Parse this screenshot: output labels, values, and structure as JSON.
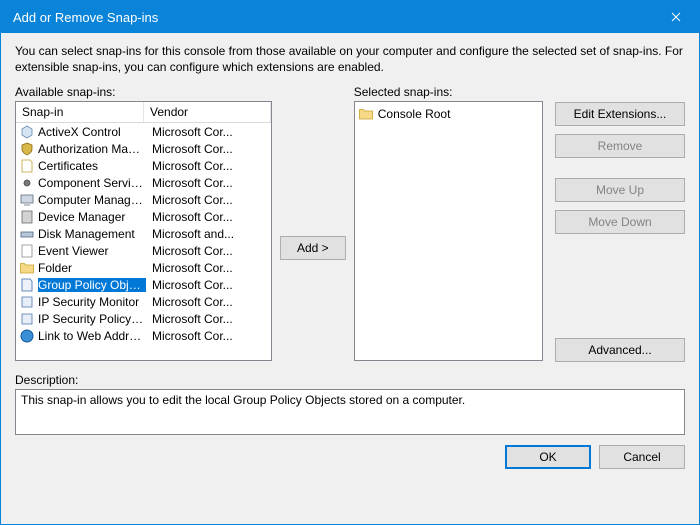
{
  "title": "Add or Remove Snap-ins",
  "intro": "You can select snap-ins for this console from those available on your computer and configure the selected set of snap-ins. For extensible snap-ins, you can configure which extensions are enabled.",
  "labels": {
    "available": "Available snap-ins:",
    "selected": "Selected snap-ins:",
    "description": "Description:"
  },
  "columns": {
    "snapin": "Snap-in",
    "vendor": "Vendor"
  },
  "available": [
    {
      "name": "ActiveX Control",
      "vendor": "Microsoft Cor...",
      "icon": "cube"
    },
    {
      "name": "Authorization Manager",
      "vendor": "Microsoft Cor...",
      "icon": "shield"
    },
    {
      "name": "Certificates",
      "vendor": "Microsoft Cor...",
      "icon": "cert"
    },
    {
      "name": "Component Services",
      "vendor": "Microsoft Cor...",
      "icon": "gear"
    },
    {
      "name": "Computer Managem...",
      "vendor": "Microsoft Cor...",
      "icon": "computer"
    },
    {
      "name": "Device Manager",
      "vendor": "Microsoft Cor...",
      "icon": "device"
    },
    {
      "name": "Disk Management",
      "vendor": "Microsoft and...",
      "icon": "disk"
    },
    {
      "name": "Event Viewer",
      "vendor": "Microsoft Cor...",
      "icon": "event"
    },
    {
      "name": "Folder",
      "vendor": "Microsoft Cor...",
      "icon": "folder"
    },
    {
      "name": "Group Policy Object ...",
      "vendor": "Microsoft Cor...",
      "icon": "gpo",
      "selected": true
    },
    {
      "name": "IP Security Monitor",
      "vendor": "Microsoft Cor...",
      "icon": "ipsec"
    },
    {
      "name": "IP Security Policy M...",
      "vendor": "Microsoft Cor...",
      "icon": "ipsec"
    },
    {
      "name": "Link to Web Address",
      "vendor": "Microsoft Cor...",
      "icon": "link"
    }
  ],
  "selected_tree": {
    "root": "Console Root"
  },
  "buttons": {
    "add": "Add >",
    "edit_extensions": "Edit Extensions...",
    "remove": "Remove",
    "move_up": "Move Up",
    "move_down": "Move Down",
    "advanced": "Advanced...",
    "ok": "OK",
    "cancel": "Cancel"
  },
  "description_text": "This snap-in allows you to edit the local Group Policy Objects stored on a computer."
}
